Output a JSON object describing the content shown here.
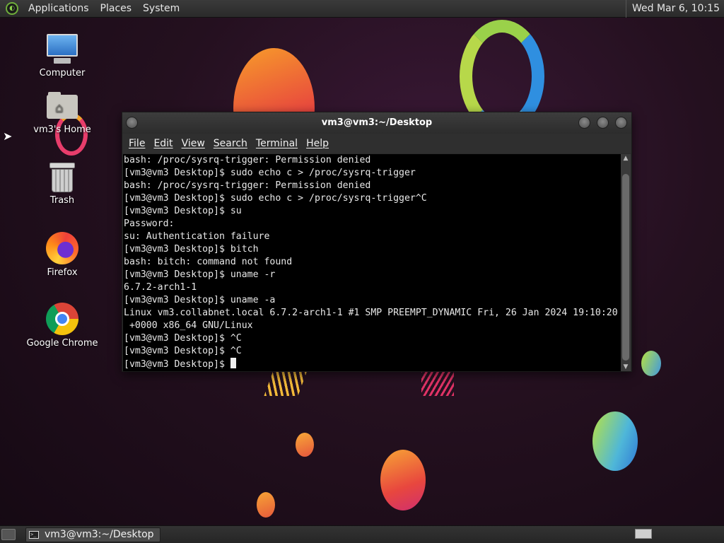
{
  "top_panel": {
    "menus": [
      "Applications",
      "Places",
      "System"
    ],
    "clock": "Wed Mar  6, 10:15"
  },
  "desktop_icons": [
    {
      "label": "Computer",
      "icon": "computer-icon"
    },
    {
      "label": "vm3's Home",
      "icon": "home-folder-icon"
    },
    {
      "label": "Trash",
      "icon": "trash-icon"
    },
    {
      "label": "Firefox",
      "icon": "firefox-icon"
    },
    {
      "label": "Google Chrome",
      "icon": "chrome-icon"
    }
  ],
  "terminal": {
    "title": "vm3@vm3:~/Desktop",
    "menu": [
      "File",
      "Edit",
      "View",
      "Search",
      "Terminal",
      "Help"
    ],
    "lines": [
      "bash: /proc/sysrq-trigger: Permission denied",
      "[vm3@vm3 Desktop]$ sudo echo c > /proc/sysrq-trigger",
      "bash: /proc/sysrq-trigger: Permission denied",
      "[vm3@vm3 Desktop]$ sudo echo c > /proc/sysrq-trigger^C",
      "[vm3@vm3 Desktop]$ su",
      "Password:",
      "su: Authentication failure",
      "[vm3@vm3 Desktop]$ bitch",
      "bash: bitch: command not found",
      "[vm3@vm3 Desktop]$ uname -r",
      "6.7.2-arch1-1",
      "[vm3@vm3 Desktop]$ uname -a",
      "Linux vm3.collabnet.local 6.7.2-arch1-1 #1 SMP PREEMPT_DYNAMIC Fri, 26 Jan 2024 19:10:20",
      " +0000 x86_64 GNU/Linux",
      "[vm3@vm3 Desktop]$ ^C",
      "[vm3@vm3 Desktop]$ ^C"
    ],
    "prompt": "[vm3@vm3 Desktop]$ "
  },
  "taskbar": {
    "window_button": "vm3@vm3:~/Desktop"
  }
}
